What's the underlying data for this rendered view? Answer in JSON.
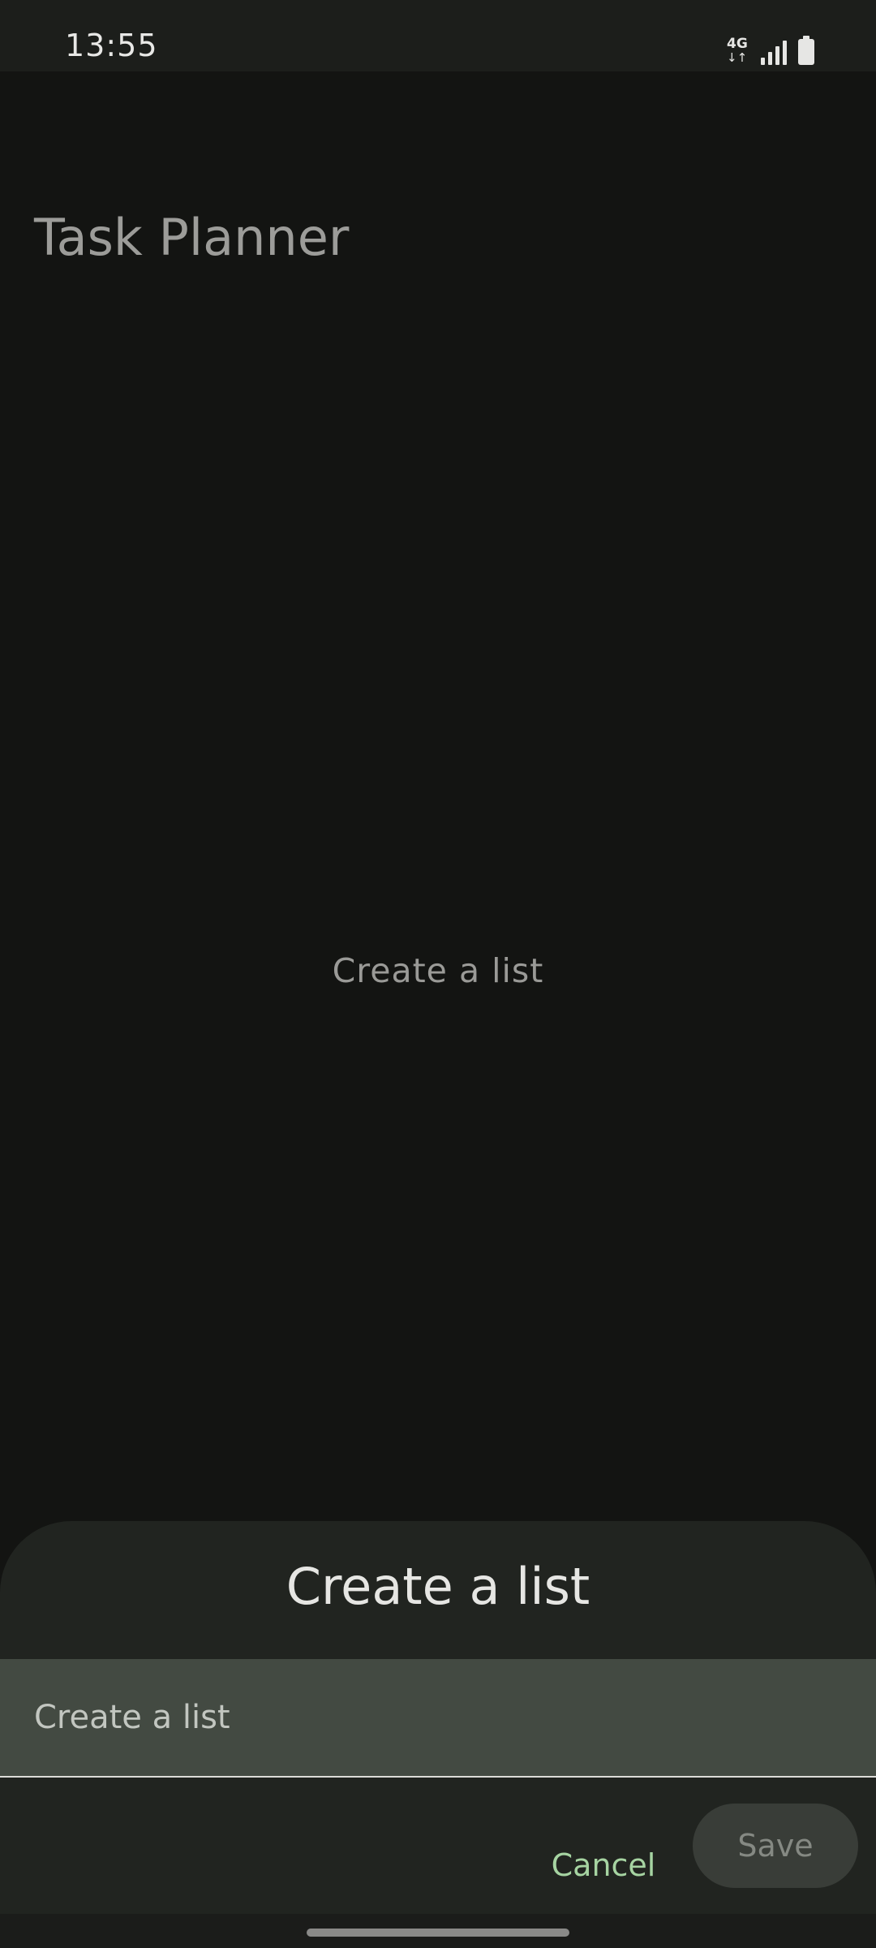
{
  "status_bar": {
    "time": "13:55",
    "network_label": "4G",
    "network_arrows": "↓↑",
    "icons": [
      "network-4g-icon",
      "signal-icon",
      "battery-icon"
    ]
  },
  "app": {
    "title": "Task Planner",
    "empty_state": "Create a list"
  },
  "dialog": {
    "title": "Create a list",
    "input_placeholder": "Create a list",
    "input_value": "",
    "cancel_label": "Cancel",
    "save_label": "Save"
  },
  "colors": {
    "background": "#131412",
    "sheet": "#212420",
    "accent": "#a6d4a2",
    "field": "#434a42"
  }
}
